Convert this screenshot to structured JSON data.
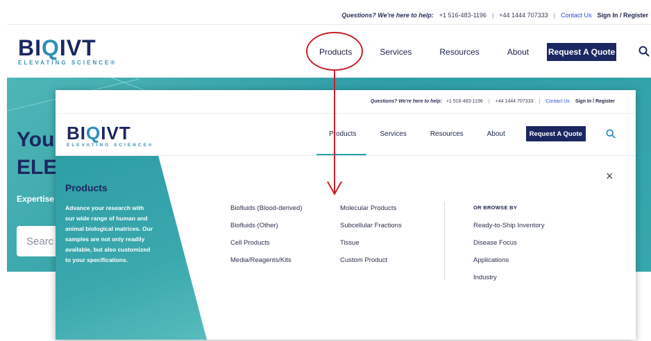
{
  "utility": {
    "question": "Questions? We're here to help:",
    "phone_us": "+1 516-483-1196",
    "sep1": "|",
    "phone_uk": "+44 1444 707333",
    "sep2": "|",
    "contact": "Contact Us",
    "signin": "Sign In / Register"
  },
  "brand": {
    "name_b": "BI",
    "name_o": "Q",
    "name_rest": "IVT",
    "tagline": "ELEVATING SCIENCE®"
  },
  "nav": {
    "products": "Products",
    "services": "Services",
    "resources": "Resources",
    "about": "About",
    "quote": "Request A Quote"
  },
  "hero": {
    "title_line1": "You",
    "title_line2": "ELE",
    "subtitle": "Expertise",
    "search_placeholder": "Searc"
  },
  "mega": {
    "panel_title": "Products",
    "panel_text": "Advance your research with our wide range of human and animal biological matrices. Our samples are not only readily available, but also customized to your specifications.",
    "col1": [
      "Biofluids (Blood-derived)",
      "Biofluids (Other)",
      "Cell Products",
      "Media/Reagents/Kits"
    ],
    "col2": [
      "Molecular Products",
      "Subcellular Fractions",
      "Tissue",
      "Custom Product"
    ],
    "browse_heading": "OR BROWSE BY",
    "col3": [
      "Ready-to-Ship Inventory",
      "Disease Focus",
      "Applications",
      "Industry"
    ],
    "close_symbol": "×"
  },
  "colors": {
    "brand_navy": "#1b2761",
    "teal": "#2f9ea6",
    "annotation_red": "#c8202a"
  },
  "icons": [
    "search-icon",
    "close-icon",
    "annotation-circle",
    "annotation-arrow"
  ]
}
